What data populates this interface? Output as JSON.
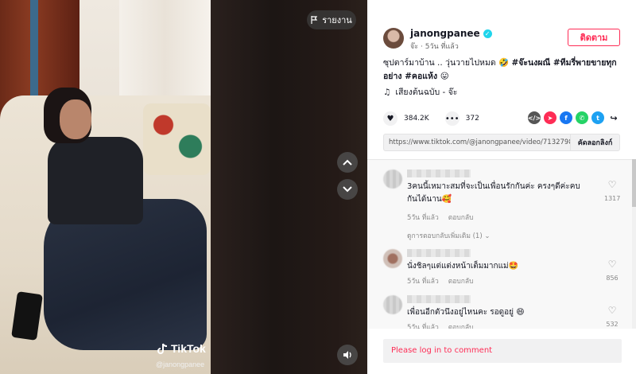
{
  "video": {
    "report_label": "รายงาน",
    "tiktok_brand": "TikTok",
    "tiktok_handle": "@janongpanee"
  },
  "author": {
    "username": "janongpanee",
    "display_name": "จ๊ะ",
    "time_ago": "5วัน ที่แล้ว",
    "follow_label": "ติดตาม"
  },
  "caption": {
    "text": "ซุปตาร์มาบ้าน .. วุ่นวายไปหมด 🤣 ",
    "tags": "#จ๊ะนงผณี #ทีมรี่พายขายทุกอย่าง #คอแห้ง 😛"
  },
  "music": {
    "label": "เสียงต้นฉบับ - จ๊ะ"
  },
  "stats": {
    "likes": "384.2K",
    "comments": "372"
  },
  "share": {
    "link": "https://www.tiktok.com/@janongpanee/video/713279836...",
    "copy_label": "คัดลอกลิงก์"
  },
  "comments": [
    {
      "text": "3คนนี้เหมาะสมที่จะเป็นเพื่อนรักกันค่ะ ครงๆดีค่ะคบกันได้นาน🥰",
      "time": "5วัน ที่แล้ว",
      "reply": "ตอบกลับ",
      "likes": "1317",
      "more_replies": "ดูการตอบกลับเพิ่มเติม (1)"
    },
    {
      "text": "นั่งชิลๆแต่แต่งหน้าเต็มมากแม่🤩",
      "time": "5วัน ที่แล้ว",
      "reply": "ตอบกลับ",
      "likes": "856"
    },
    {
      "text": "เพื่อนอีกตัวนึงอยู่ไหนคะ รอดูอยู่ 😄",
      "time": "5วัน ที่แล้ว",
      "reply": "ตอบกลับ",
      "likes": "532"
    }
  ],
  "login_prompt": "Please log in to comment",
  "colors": {
    "accent": "#fe2c55",
    "verified": "#20d5ec",
    "share_embed": "#555555",
    "share_red": "#fe2c55",
    "share_facebook": "#1877f2",
    "share_whatsapp": "#25d366",
    "share_twitter": "#1da1f2"
  }
}
